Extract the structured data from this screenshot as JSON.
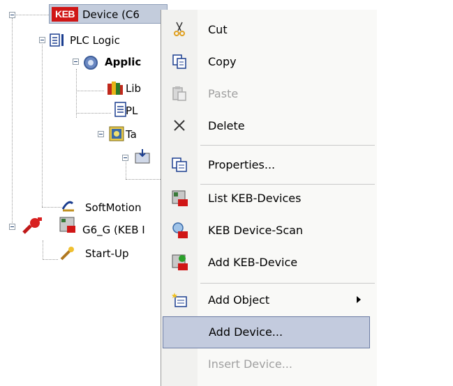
{
  "tree": {
    "device": {
      "label": "Device (C6",
      "logo_text": "KEB"
    },
    "plc_logic": {
      "label": "PLC Logic"
    },
    "application": {
      "label": "Applic"
    },
    "library": {
      "label": "Lib"
    },
    "plc_prg": {
      "label": "PL"
    },
    "task_config": {
      "label": "Ta"
    },
    "softmotion": {
      "label": "SoftMotion"
    },
    "g6": {
      "label": "G6_G (KEB I"
    },
    "startup": {
      "label": "Start-Up"
    }
  },
  "context_menu": {
    "items": [
      {
        "label": "Cut",
        "icon": "scissors-icon",
        "enabled": true
      },
      {
        "label": "Copy",
        "icon": "copy-icon",
        "enabled": true
      },
      {
        "label": "Paste",
        "icon": "paste-icon",
        "enabled": false
      },
      {
        "label": "Delete",
        "icon": "delete-x-icon",
        "enabled": true
      },
      {
        "label": "Properties...",
        "icon": "properties-icon",
        "enabled": true
      },
      {
        "label": "List KEB-Devices",
        "icon": "keb-list-icon",
        "enabled": true
      },
      {
        "label": "KEB Device-Scan",
        "icon": "keb-scan-icon",
        "enabled": true
      },
      {
        "label": "Add KEB-Device",
        "icon": "keb-add-icon",
        "enabled": true
      },
      {
        "label": "Add Object",
        "icon": "add-object-icon",
        "enabled": true,
        "has_submenu": true
      },
      {
        "label": "Add Device...",
        "icon": "",
        "enabled": true,
        "highlighted": true
      },
      {
        "label": "Insert Device...",
        "icon": "",
        "enabled": false
      }
    ]
  },
  "colors": {
    "keb_red": "#d01616",
    "selection": "#c3ccdc",
    "menu_highlight": "#c3cbde",
    "disabled_text": "#a0a0a0"
  }
}
